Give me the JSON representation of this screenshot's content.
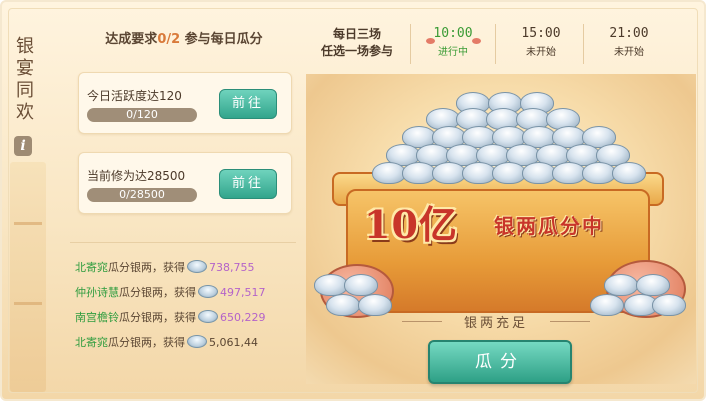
{
  "side_title": "银宴同欢",
  "info_badge": "i",
  "header": {
    "requirement_prefix": "达成要求",
    "requirement_progress": "0/2",
    "requirement_suffix": " 参与每日瓜分"
  },
  "tasks": [
    {
      "title": "今日活跃度达120",
      "progress_text": "0/120",
      "progress": 0,
      "button": "前往"
    },
    {
      "title": "当前修为达28500",
      "progress_text": "0/28500",
      "progress": 0,
      "button": "前往"
    }
  ],
  "feed": [
    {
      "name": "北寄窕",
      "action": "瓜分银两，获得",
      "amount": "738,755"
    },
    {
      "name": "仲孙诗慧",
      "action": "瓜分银两，获得",
      "amount": "497,517"
    },
    {
      "name": "南宫檐铃",
      "action": "瓜分银两，获得",
      "amount": "650,229"
    },
    {
      "name": "北寄窕",
      "action": "瓜分银两，获得",
      "amount": "5,061,44"
    }
  ],
  "schedule": {
    "line1": "每日三场",
    "line2": "任选一场参与",
    "slots": [
      {
        "time": "10:00",
        "status": "进行中"
      },
      {
        "time": "15:00",
        "status": "未开始"
      },
      {
        "time": "21:00",
        "status": "未开始"
      }
    ]
  },
  "banner": {
    "headline": "10亿",
    "headline_sub": "银两瓜分中",
    "status": "银两充足",
    "share_button": "瓜分"
  },
  "colors": {
    "accent_green": "#3a9b35",
    "name_green": "#2e9c3e",
    "amount_purple": "#b463c9",
    "button_teal": "#32a58c",
    "headline_red": "#c8352a"
  }
}
